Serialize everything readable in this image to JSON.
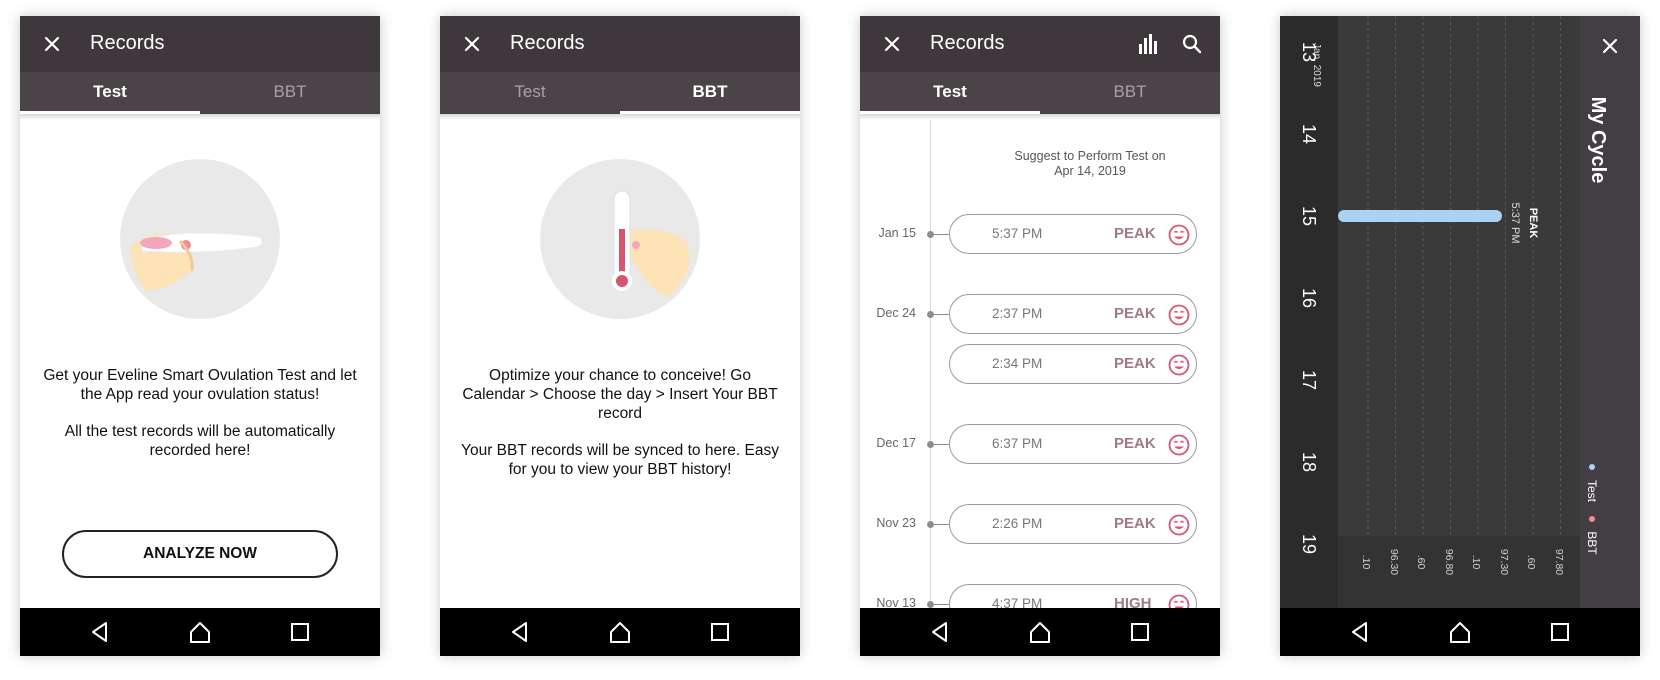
{
  "screen1": {
    "title": "Records",
    "tabs": [
      "Test",
      "BBT"
    ],
    "message_line1": "Get your Eveline Smart Ovulation Test and let the App read your ovulation status!",
    "message_line2": "All the test records will be automatically recorded here!",
    "button": "ANALYZE NOW"
  },
  "screen2": {
    "title": "Records",
    "tabs": [
      "Test",
      "BBT"
    ],
    "message_line1": "Optimize your chance to conceive! Go Calendar > Choose the day > Insert Your BBT record",
    "message_line2": "Your BBT records will be synced to here. Easy for you to view your BBT history!"
  },
  "screen3": {
    "title": "Records",
    "tabs": [
      "Test",
      "BBT"
    ],
    "suggest": "Suggest to Perform Test on\nApr 14, 2019",
    "records": [
      {
        "date": "Jan 15",
        "time": "5:37 PM",
        "level": "PEAK"
      },
      {
        "date": "Dec 24",
        "time": "2:37 PM",
        "level": "PEAK"
      },
      {
        "date": "",
        "time": "2:34 PM",
        "level": "PEAK"
      },
      {
        "date": "Dec 17",
        "time": "6:37 PM",
        "level": "PEAK"
      },
      {
        "date": "Nov 23",
        "time": "2:26 PM",
        "level": "PEAK"
      },
      {
        "date": "Nov 13",
        "time": "4:37 PM",
        "level": "HIGH"
      }
    ]
  },
  "screen4": {
    "title": "My Cycle",
    "month_label": "Jan, 2019",
    "days": [
      "13",
      "14",
      "15",
      "16",
      "17",
      "18",
      "19"
    ],
    "peak_label": "PEAK",
    "peak_time": "5:37 PM",
    "temp_ticks": [
      ".10",
      "96.30",
      ".60",
      "96.80",
      ".10",
      "97.30",
      ".60",
      "97.80"
    ],
    "legend_test": "Test",
    "legend_bbt": "BBT",
    "test_color": "#a9d3f5",
    "bbt_color": "#f08a99"
  },
  "colors": {
    "appbar": "#3e383d",
    "tabbar": "#4a4348",
    "accent_pink": "#d9546e",
    "level_text": "#a07b86"
  }
}
